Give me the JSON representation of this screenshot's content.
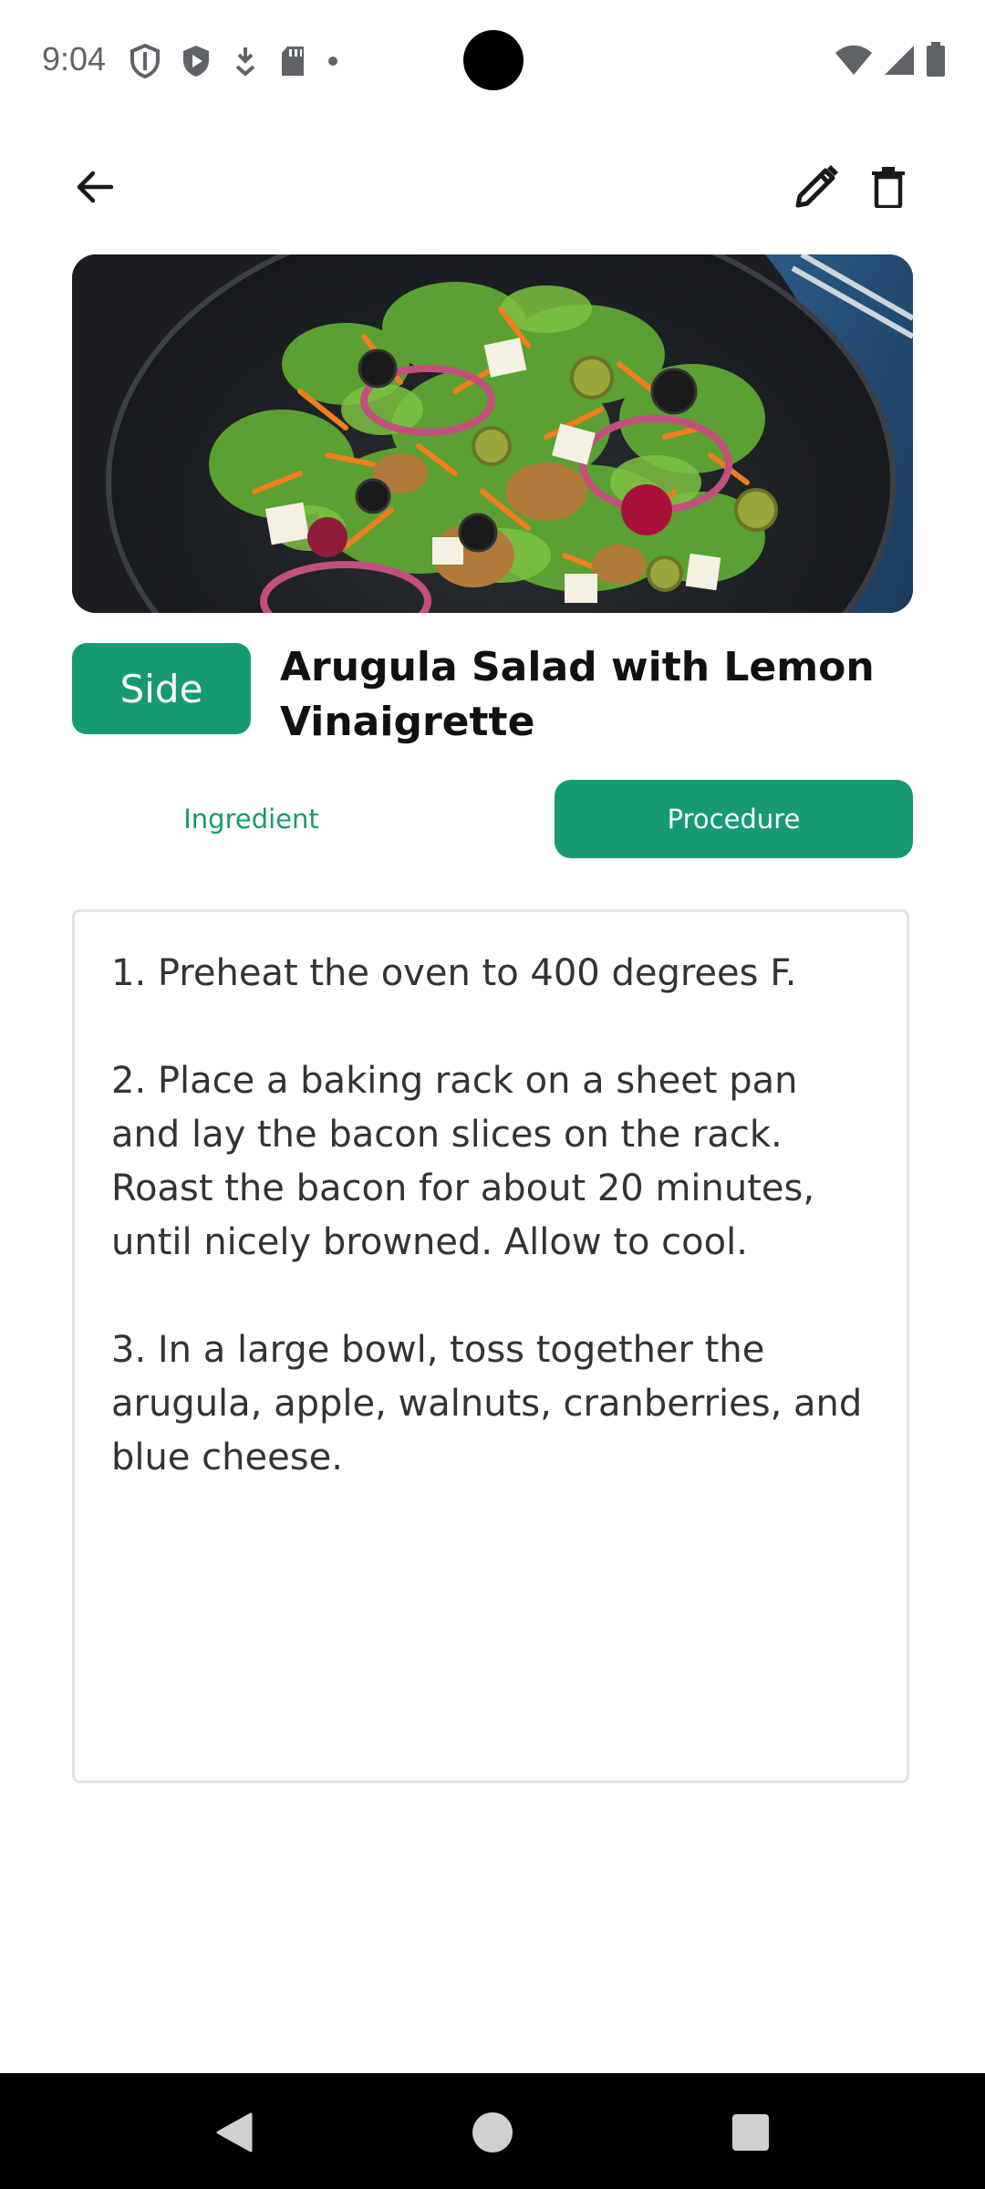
{
  "status_bar": {
    "time": "9:04",
    "left_icons": [
      "shield-outline-icon",
      "play-shield-icon",
      "download-arrow-icon",
      "sd-card-icon",
      "dot-icon"
    ],
    "right_icons": [
      "wifi-icon",
      "signal-icon",
      "battery-icon"
    ]
  },
  "app_bar": {
    "icons": [
      "arrow-back-icon",
      "edit-pencil-icon",
      "delete-trash-icon"
    ]
  },
  "recipe": {
    "category": "Side",
    "title": "Arugula Salad with Lemon Vinaigrette",
    "image_alt": "salad-photo"
  },
  "tabs": [
    {
      "label": "Ingredient",
      "selected": false
    },
    {
      "label": "Procedure",
      "selected": true
    }
  ],
  "procedure": {
    "text": "1. Preheat the oven to 400 degrees F.\n\n2. Place a baking rack on a sheet pan and lay the bacon slices on the rack. Roast the bacon for about 20 minutes, until nicely browned. Allow to cool.\n\n3. In a large bowl, toss together the arugula, apple, walnuts, cranberries, and blue cheese."
  },
  "nav_bar": {
    "icons": [
      "nav-back-triangle-icon",
      "nav-home-circle-icon",
      "nav-recents-square-icon"
    ]
  },
  "colors": {
    "accent": "#179a72",
    "text": "#111111",
    "body_text": "#333333",
    "border": "#e3e3e3"
  }
}
